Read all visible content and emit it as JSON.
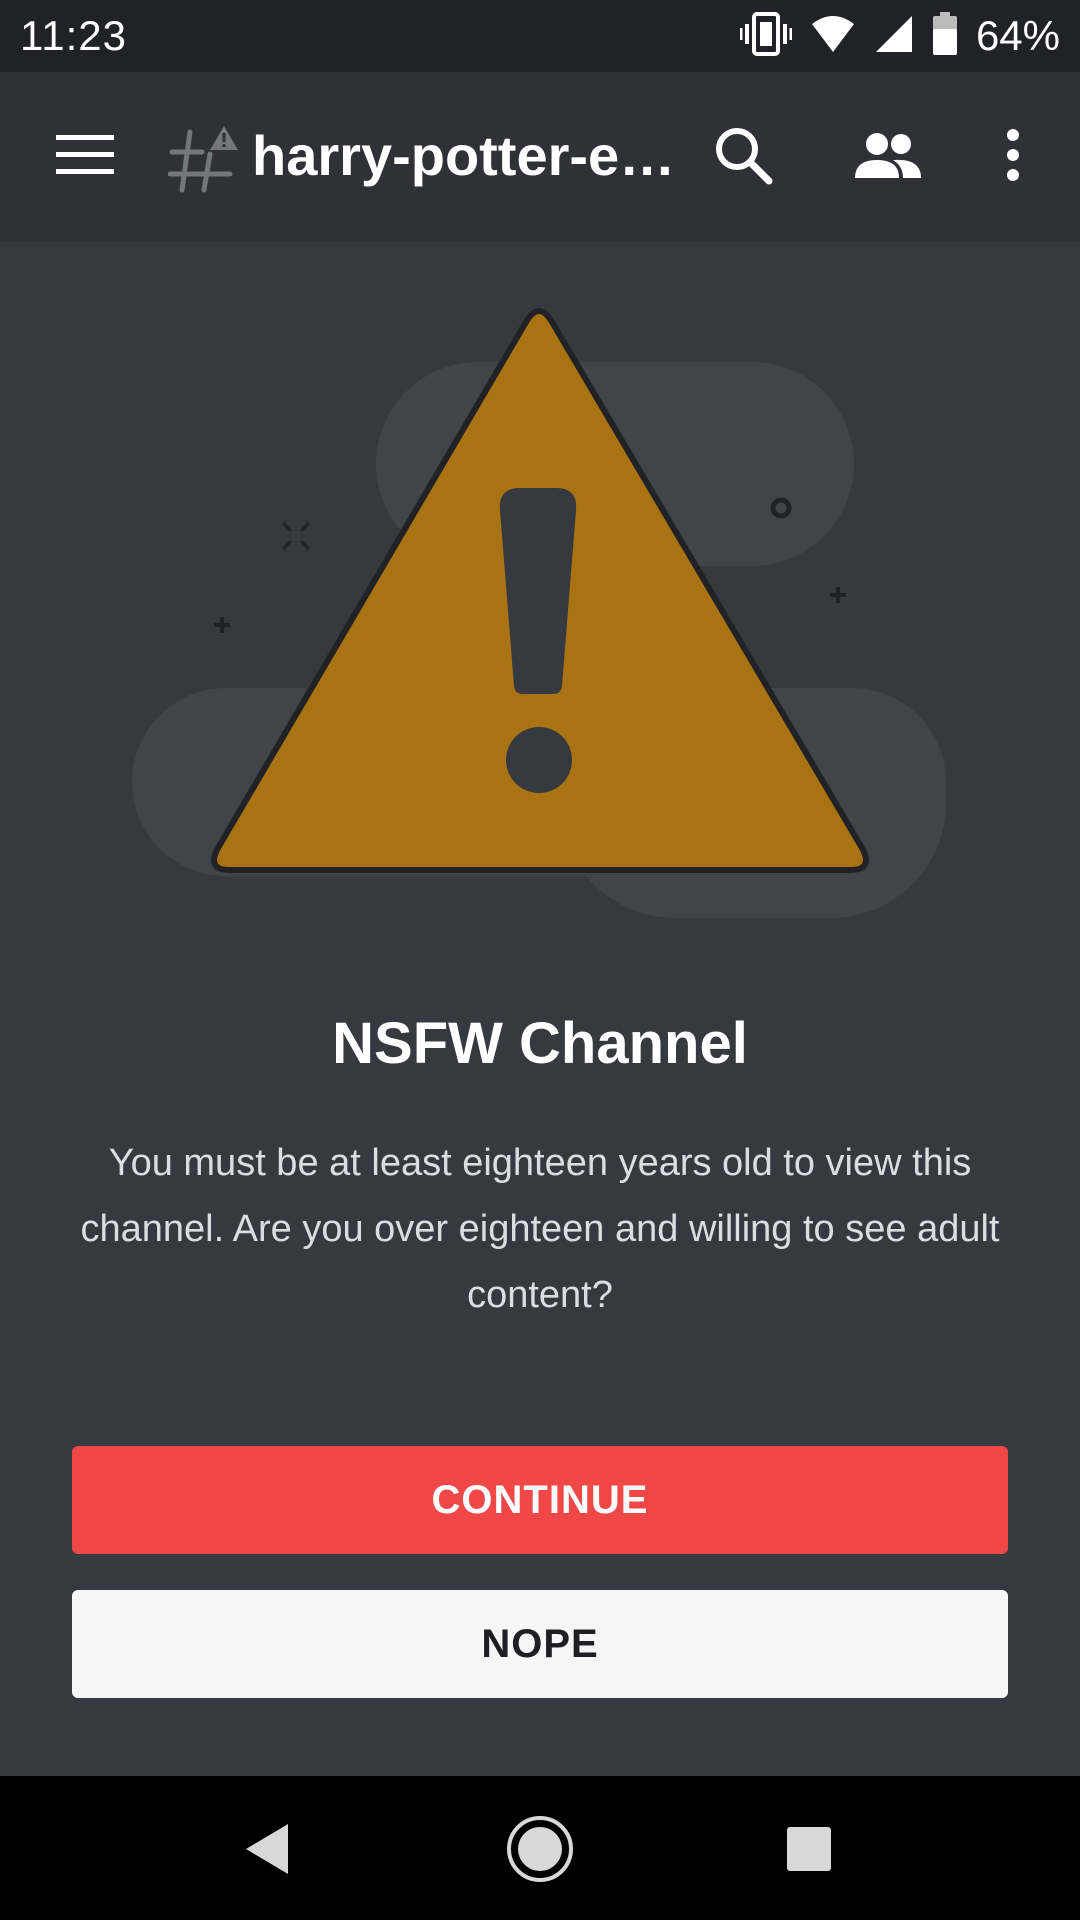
{
  "status_bar": {
    "time": "11:23",
    "battery_percent": "64%",
    "icons": [
      "vibrate-icon",
      "wifi-icon",
      "signal-icon",
      "battery-icon"
    ]
  },
  "app_bar": {
    "channel_name": "harry-potter-e…",
    "icons": [
      "menu-icon",
      "nsfw-channel-icon",
      "search-icon",
      "members-icon",
      "more-vert-icon"
    ]
  },
  "content": {
    "title": "NSFW Channel",
    "message": "You must be at least eighteen years old to view this channel. Are you over eighteen and willing to see adult content?",
    "continue_label": "CONTINUE",
    "nope_label": "NOPE"
  },
  "nav_bar": {
    "icons": [
      "back-icon",
      "home-icon",
      "recents-icon"
    ]
  },
  "colors": {
    "background": "#36393f",
    "app_bar": "#2f3136",
    "status_bar": "#202225",
    "warning": "#a97213",
    "continue": "#f04747",
    "nope": "#f6f6f7"
  }
}
